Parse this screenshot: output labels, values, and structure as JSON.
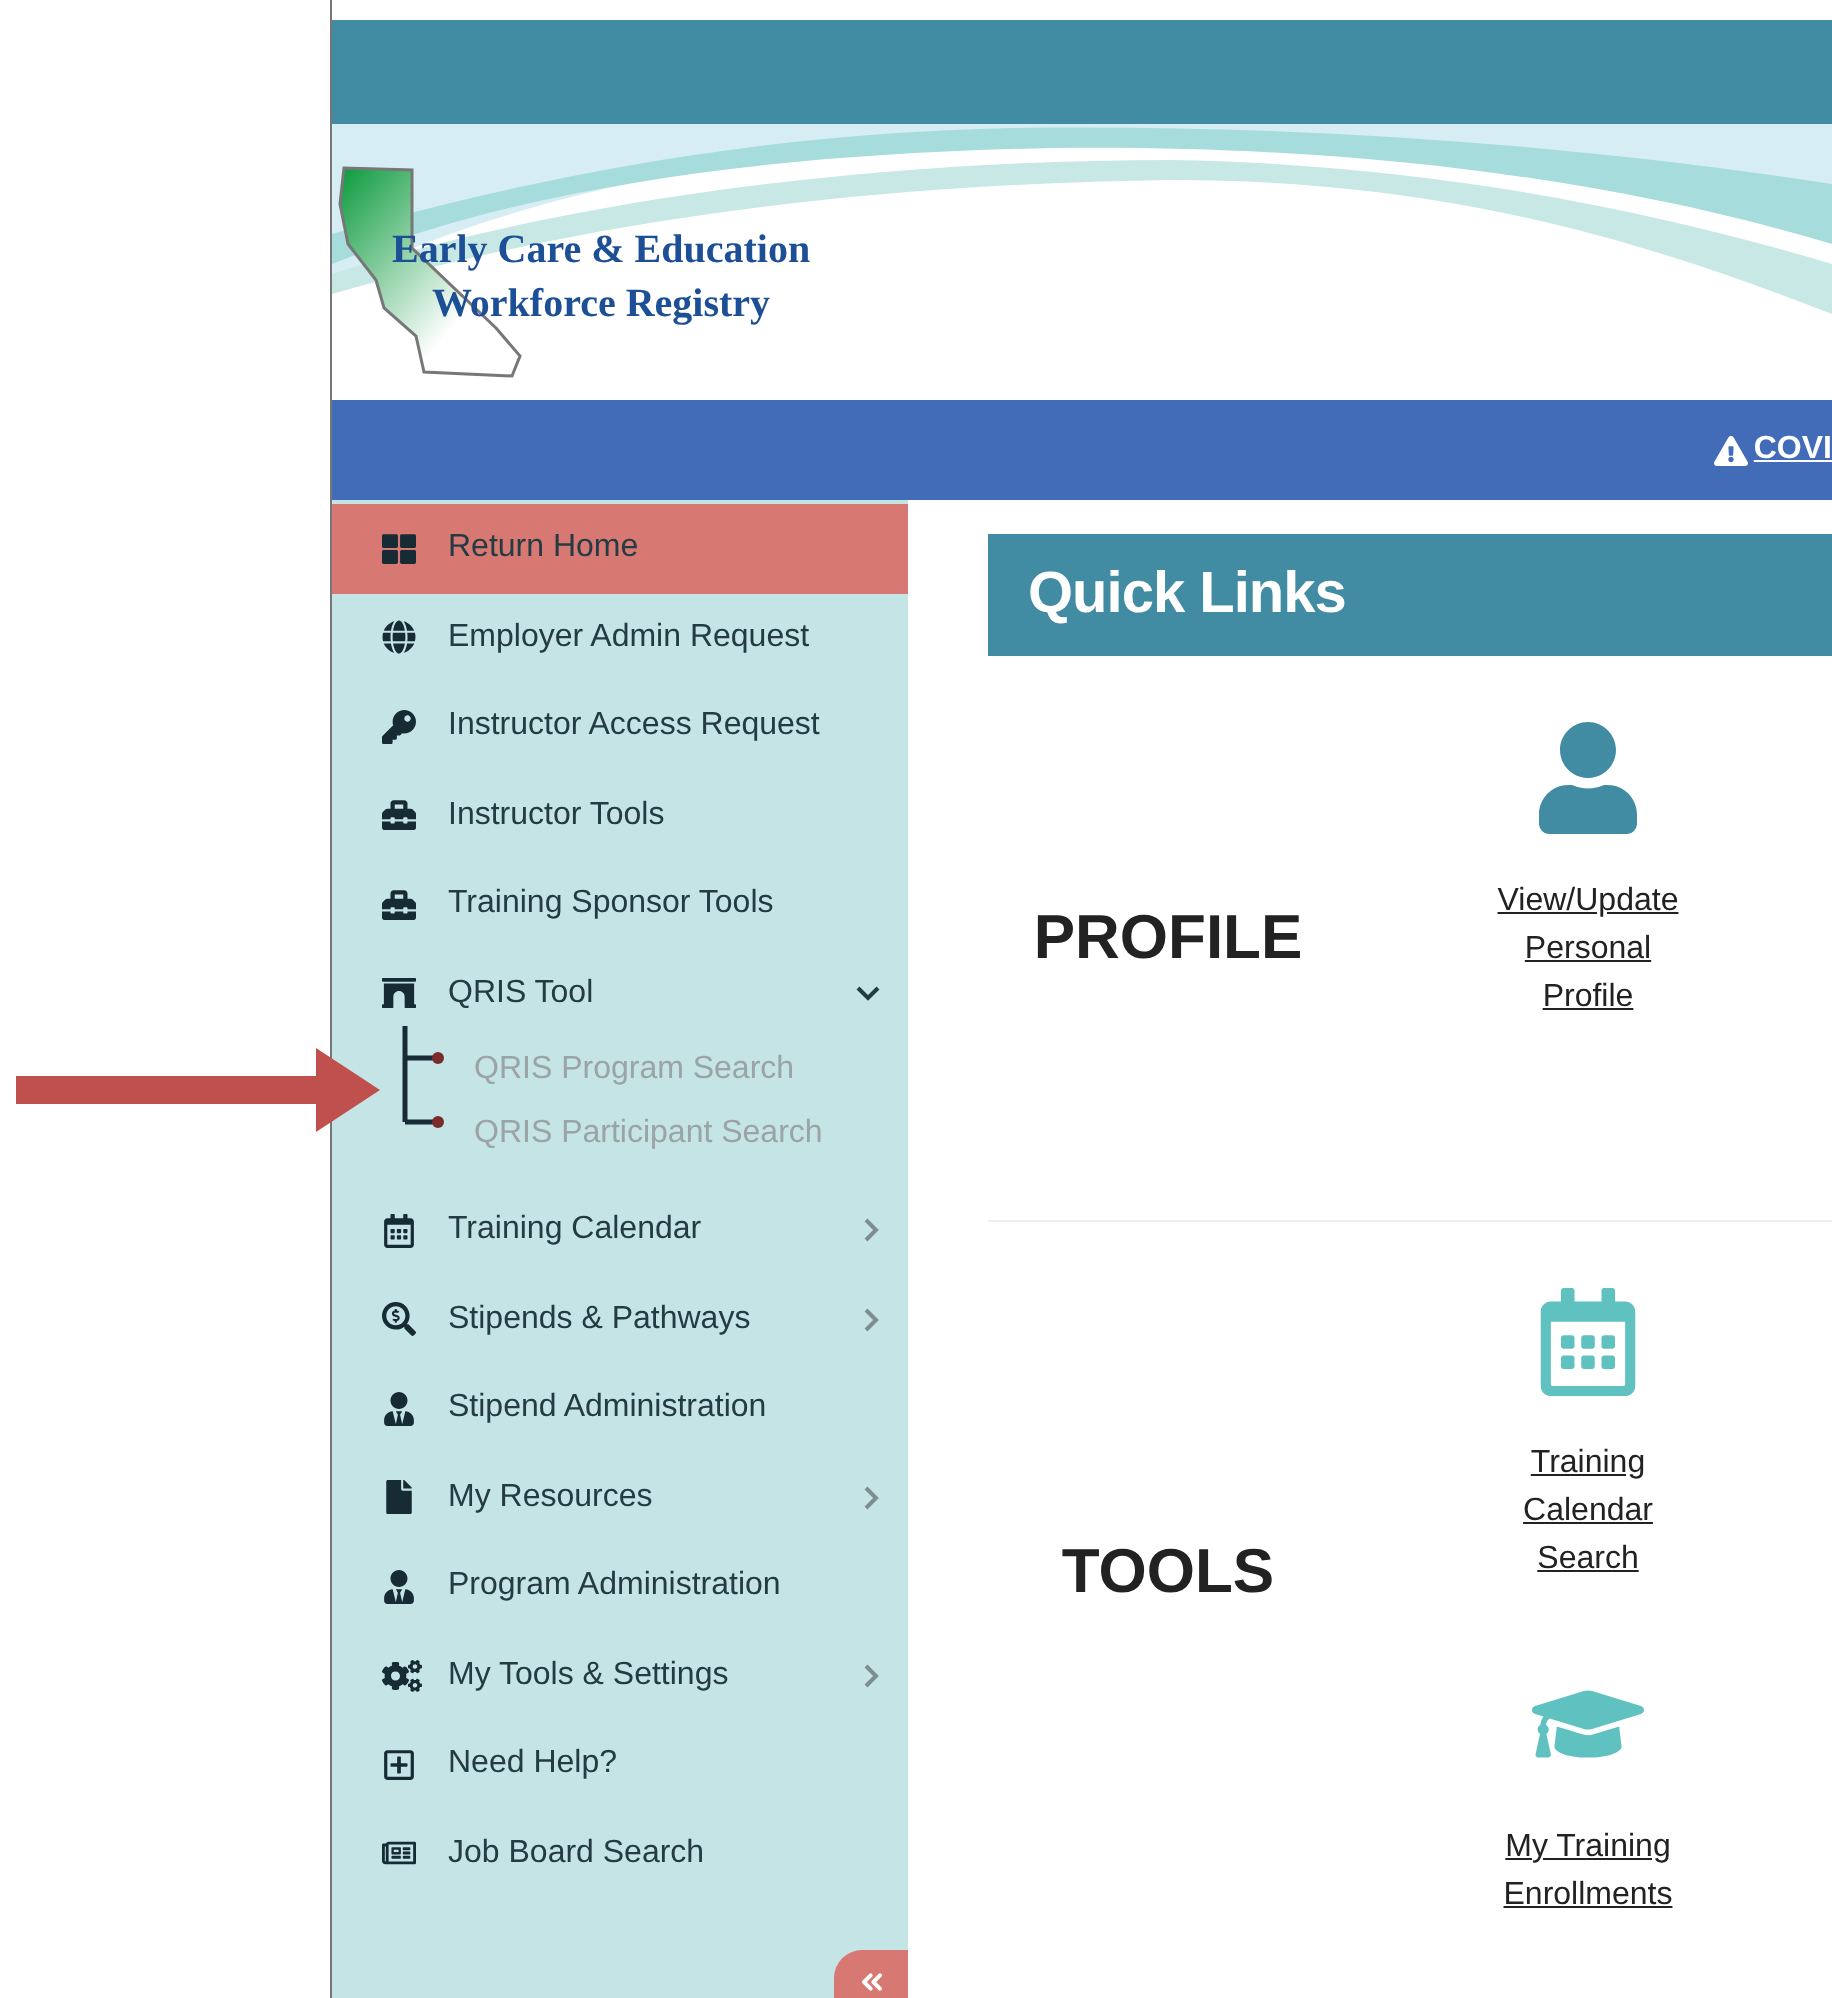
{
  "logo": {
    "lines": [
      "Early Care & Education",
      "Workforce Registry"
    ]
  },
  "alert_bar": {
    "link": "COVI"
  },
  "sidebar": {
    "items": [
      {
        "label": "Return Home",
        "selected": true
      },
      {
        "label": "Employer Admin Request",
        "selected": false
      },
      {
        "label": "Instructor Access Request",
        "selected": false
      },
      {
        "label": "Instructor Tools",
        "selected": false
      },
      {
        "label": "Training Sponsor Tools",
        "selected": false
      },
      {
        "label": "QRIS Tool",
        "selected": false,
        "expanded": true,
        "children": [
          {
            "label": "QRIS Program Search"
          },
          {
            "label": "QRIS Participant Search"
          }
        ]
      },
      {
        "label": "Training Calendar",
        "selected": false,
        "expanded": false
      },
      {
        "label": "Stipends & Pathways",
        "selected": false,
        "expanded": false
      },
      {
        "label": "Stipend Administration",
        "selected": false
      },
      {
        "label": "My Resources",
        "selected": false,
        "expanded": false
      },
      {
        "label": "Program Administration",
        "selected": false
      },
      {
        "label": "My Tools & Settings",
        "selected": false,
        "expanded": false
      },
      {
        "label": "Need Help?",
        "selected": false
      },
      {
        "label": "Job Board Search",
        "selected": false
      }
    ]
  },
  "quick_links": {
    "title": "Quick Links",
    "sections": [
      {
        "title": "PROFILE",
        "links": [
          {
            "label": "View/Update Personal Profile"
          }
        ]
      },
      {
        "title": "TOOLS",
        "links": [
          {
            "label": "Training Calendar Search"
          },
          {
            "label": "My Training Enrollments"
          }
        ]
      }
    ]
  }
}
